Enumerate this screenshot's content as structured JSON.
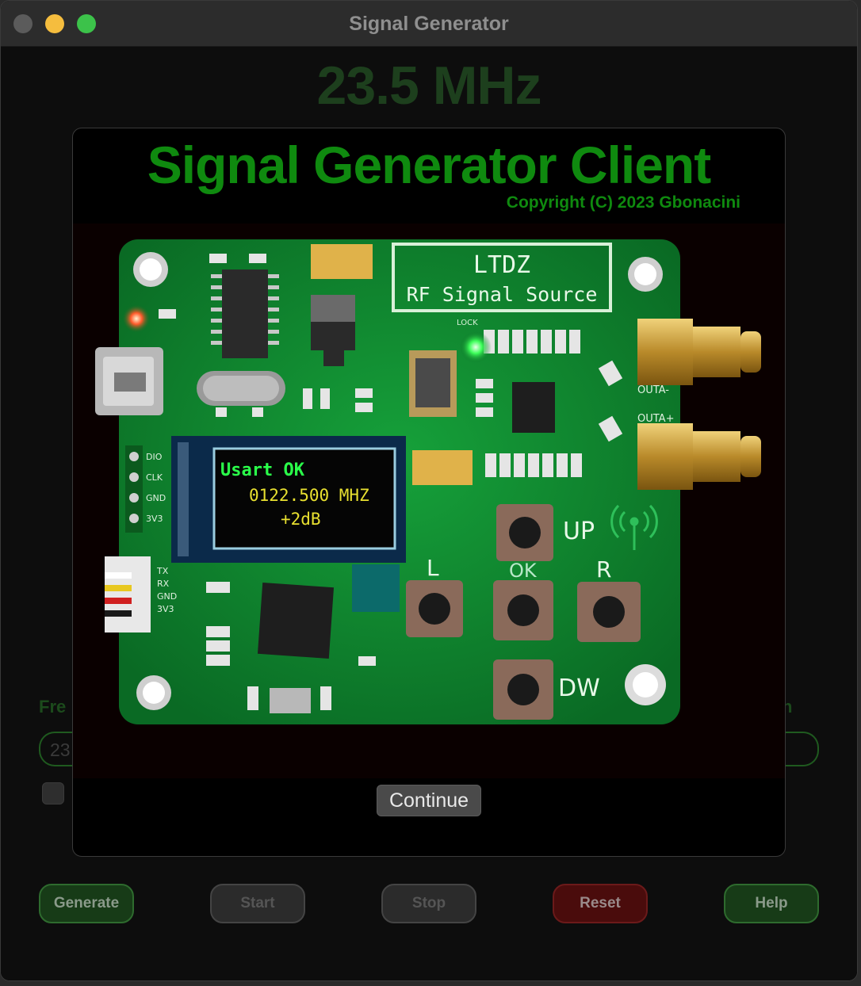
{
  "window": {
    "title": "Signal Generator"
  },
  "display": {
    "frequency": "23.5 MHz"
  },
  "form": {
    "freq_label_partial": "Fre",
    "freq_value_partial": "23",
    "right_label_partial": "n"
  },
  "buttons": {
    "generate": "Generate",
    "start": "Start",
    "stop": "Stop",
    "reset": "Reset",
    "help": "Help"
  },
  "modal": {
    "title": "Signal Generator Client",
    "copyright": "Copyright (C) 2023 Gbonacini",
    "continue": "Continue",
    "board": {
      "name_line1": "LTDZ",
      "name_line2": "RF Signal Source",
      "oled_line1": "Usart   OK",
      "oled_line2": "0122.500 MHZ",
      "oled_line3": "+2dB",
      "button_up": "UP",
      "button_ok": "OK",
      "button_left": "L",
      "button_right": "R",
      "button_down": "DW",
      "port_a": "OUTA-",
      "port_b": "OUTA+",
      "pin_labels_left": [
        "DIO",
        "CLK",
        "GND",
        "3V3"
      ],
      "uart_labels": [
        "TX",
        "RX",
        "GND",
        "3V3"
      ],
      "led_label": "LOCK"
    }
  },
  "colors": {
    "accent_green": "#0f8a0f",
    "board_green": "#0c7a2a",
    "reset_red": "#4a0c0c"
  }
}
